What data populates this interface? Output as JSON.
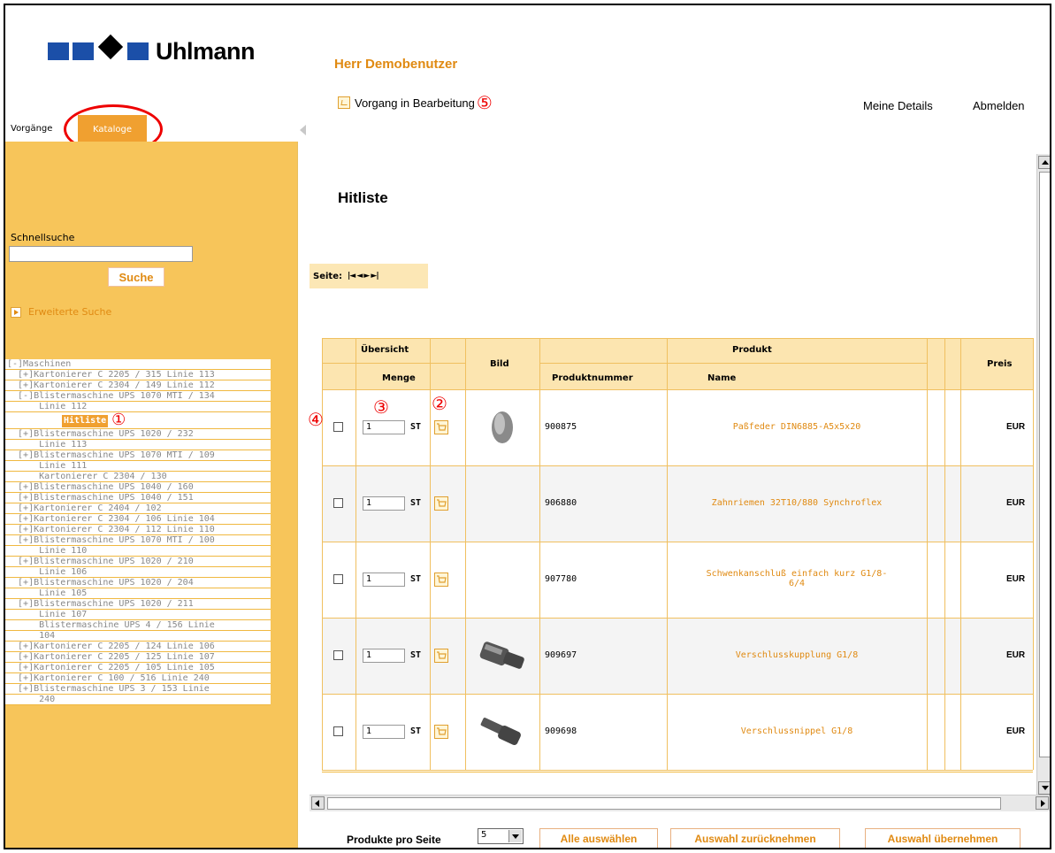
{
  "header": {
    "brand": "Uhlmann",
    "username": "Herr Demobenutzer",
    "vorgang_label": "Vorgang in Bearbeitung",
    "vorgang_marker": "⑤",
    "details_link": "Meine Details",
    "logout_link": "Abmelden"
  },
  "sidebar": {
    "tabs": [
      {
        "label": "Vorgänge",
        "active": false
      },
      {
        "label": "Kataloge",
        "active": true
      }
    ],
    "quicksearch_label": "Schnellsuche",
    "quicksearch_value": "",
    "search_button": "Suche",
    "advanced_search": "Erweiterte Suche",
    "tree": [
      "[-]Maschinen",
      "  [+]Kartonierer C 2205 / 315 Linie 113",
      "  [+]Kartonierer C 2304 / 149 Linie 112",
      "  [-]Blistermaschine UPS 1070 MTI / 134",
      "      Linie 112",
      "HIT",
      "  [+]Blistermaschine UPS 1020 / 232",
      "      Linie 113",
      "  [+]Blistermaschine UPS 1070 MTI / 109",
      "      Linie 111",
      "      Kartonierer C 2304 / 130",
      "  [+]Blistermaschine UPS 1040 / 160",
      "  [+]Blistermaschine UPS 1040 / 151",
      "  [+]Kartonierer C 2404 / 102",
      "  [+]Kartonierer C 2304 / 106 Linie 104",
      "  [+]Kartonierer C 2304 / 112 Linie 110",
      "  [+]Blistermaschine UPS 1070 MTI / 100",
      "      Linie 110",
      "  [+]Blistermaschine UPS 1020 / 210",
      "      Linie 106",
      "  [+]Blistermaschine UPS 1020 / 204",
      "      Linie 105",
      "  [+]Blistermaschine UPS 1020 / 211",
      "      Linie 107",
      "      Blistermaschine UPS 4 / 156 Linie",
      "      104",
      "  [+]Kartonierer C 2205 / 124 Linie 106",
      "  [+]Kartonierer C 2205 / 125 Linie 107",
      "  [+]Kartonierer C 2205 / 105 Linie 105",
      "  [+]Kartonierer C 100 / 516 Linie 240",
      "  [+]Blistermaschine UPS 3 / 153 Linie",
      "      240"
    ],
    "hitliste_label": "Hitliste",
    "hitliste_marker": "①"
  },
  "main": {
    "title": "Hitliste",
    "pager_label": "Seite:",
    "pager_buttons": "|◄ ◄ ► ►|",
    "table": {
      "group_headers": {
        "overview": "Übersicht",
        "image": "Bild",
        "product": "Produkt",
        "price": "Preis"
      },
      "sub_headers": {
        "quantity": "Menge",
        "number": "Produktnummer",
        "name": "Name"
      },
      "markers": {
        "cart": "②",
        "qty": "③",
        "check": "④"
      },
      "rows": [
        {
          "qty": "1",
          "unit": "ST",
          "number": "900875",
          "name": "Paßfeder DIN6885-A5x5x20",
          "currency": "EUR",
          "image": "key"
        },
        {
          "qty": "1",
          "unit": "ST",
          "number": "906880",
          "name": "Zahnriemen 32T10/880 Synchroflex",
          "currency": "EUR",
          "image": ""
        },
        {
          "qty": "1",
          "unit": "ST",
          "number": "907780",
          "name": "Schwenkanschluß einfach kurz G1/8-\n6/4",
          "currency": "EUR",
          "image": ""
        },
        {
          "qty": "1",
          "unit": "ST",
          "number": "909697",
          "name": "Verschlusskupplung G1/8",
          "currency": "EUR",
          "image": "coupling"
        },
        {
          "qty": "1",
          "unit": "ST",
          "number": "909698",
          "name": "Verschlussnippel G1/8",
          "currency": "EUR",
          "image": "nipple"
        }
      ]
    },
    "footer": {
      "per_page_label": "Produkte pro Seite",
      "per_page_value": "5",
      "select_all": "Alle auswählen",
      "deselect": "Auswahl zurücknehmen",
      "apply": "Auswahl übernehmen"
    }
  },
  "colors": {
    "accent": "#f0a030",
    "sidebar": "#f7c55a",
    "link": "#e08a12",
    "annotation": "#e00000",
    "brand_blue": "#1b4fa8"
  }
}
